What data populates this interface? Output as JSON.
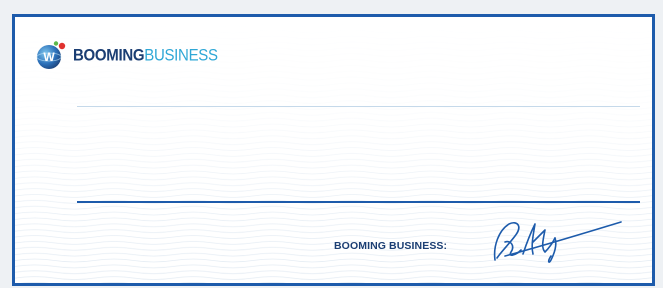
{
  "brand": {
    "part1": "BOOMING",
    "part2": "BUSINESS",
    "mark_letter": "W"
  },
  "signature": {
    "label": "BOOMING BUSINESS:"
  },
  "colors": {
    "border": "#1d5bab",
    "brand_dark": "#1b3e73",
    "brand_light": "#2ea7d6",
    "signature_ink": "#1d5bab"
  }
}
